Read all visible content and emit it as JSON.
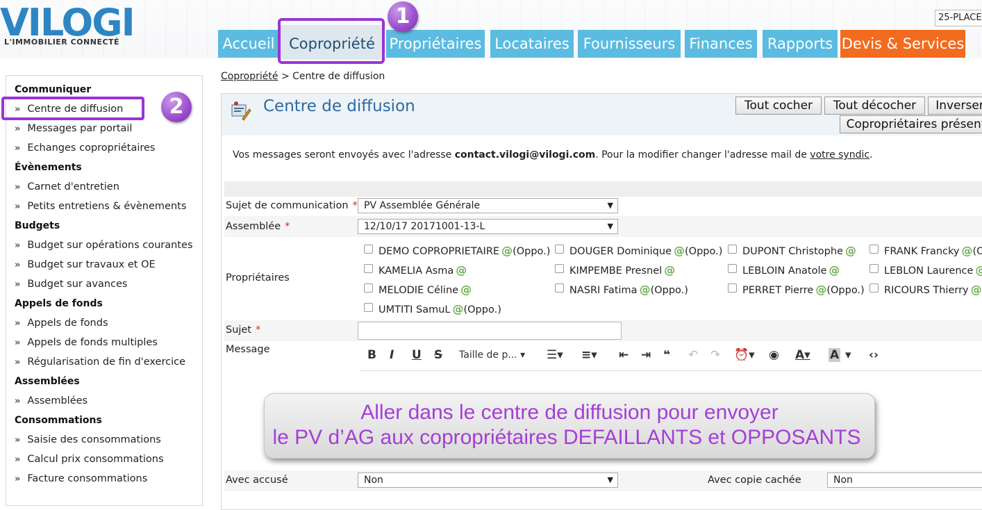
{
  "header": {
    "logo_word": "VILOGI",
    "logo_tagline": "L'IMMOBILIER CONNECTÉ",
    "building_selector": "25-PLACE",
    "tabs": [
      {
        "label": "Accueil"
      },
      {
        "label": "Copropriété"
      },
      {
        "label": "Propriétaires"
      },
      {
        "label": "Locataires"
      },
      {
        "label": "Fournisseurs"
      },
      {
        "label": "Finances"
      },
      {
        "label": "Rapports"
      },
      {
        "label": "Devis & Services"
      }
    ],
    "badge_1": "1",
    "badge_2": "2"
  },
  "sidebar": {
    "sections": [
      {
        "heading": "Communiquer",
        "items": [
          "Centre de diffusion",
          "Messages par portail",
          "Echanges copropriétaires"
        ]
      },
      {
        "heading": "Évènements",
        "items": [
          "Carnet d'entretien",
          "Petits entretiens & évènements"
        ]
      },
      {
        "heading": "Budgets",
        "items": [
          "Budget sur opérations courantes",
          "Budget sur travaux et OE",
          "Budget sur avances"
        ]
      },
      {
        "heading": "Appels de fonds",
        "items": [
          "Appels de fonds",
          "Appels de fonds multiples",
          "Régularisation de fin d'exercice"
        ]
      },
      {
        "heading": "Assemblées",
        "items": [
          "Assemblées"
        ]
      },
      {
        "heading": "Consommations",
        "items": [
          "Saisie des consommations",
          "Calcul prix consommations",
          "Facture consommations"
        ]
      }
    ]
  },
  "breadcrumb": {
    "parent": "Copropriété",
    "separator": " > ",
    "current": "Centre de diffusion"
  },
  "panel": {
    "title": "Centre de diffusion",
    "buttons": {
      "check_all": "Tout cocher",
      "uncheck_all": "Tout décocher",
      "invert": "Inverser",
      "present_owners": "Copropriétaires présent"
    },
    "info": {
      "prefix": "Vos messages seront envoyés avec l'adresse ",
      "email": "contact.vilogi@vilogi.com",
      "middle": ". Pour la modifier changer l'adresse mail de ",
      "link": "votre syndic",
      "suffix": "."
    }
  },
  "form": {
    "subject_comm_label": "Sujet de communication",
    "subject_comm_value": "PV Assemblée Générale",
    "assembly_label": "Assemblée",
    "assembly_value": "12/10/17 20171001-13-L",
    "owners_label": "Propriétaires",
    "owners": [
      {
        "name": "DEMO COPROPRIETAIRE",
        "oppo": "(Oppo.)"
      },
      {
        "name": "DOUGER Dominique",
        "oppo": "(Oppo.)"
      },
      {
        "name": "DUPONT Christophe",
        "oppo": ""
      },
      {
        "name": "FRANK Francky",
        "oppo": "(O"
      },
      {
        "name": "KAMELIA Asma",
        "oppo": ""
      },
      {
        "name": "KIMPEMBE Presnel",
        "oppo": ""
      },
      {
        "name": "LEBLOIN Anatole",
        "oppo": ""
      },
      {
        "name": "LEBLON Laurence",
        "oppo": ""
      },
      {
        "name": "MELODIE Céline",
        "oppo": ""
      },
      {
        "name": "NASRI Fatima",
        "oppo": "(Oppo.)"
      },
      {
        "name": "PERRET Pierre",
        "oppo": "(Oppo.)"
      },
      {
        "name": "RICOURS Thierry",
        "oppo": ""
      },
      {
        "name": "UMTITI SamuL",
        "oppo": "(Oppo.)"
      }
    ],
    "at_sign": "@",
    "required_mark": "*",
    "subject_label": "Sujet",
    "message_label": "Message",
    "font_size_placeholder": "Taille de p...",
    "ack_label": "Avec accusé",
    "ack_value": "Non",
    "bcc_label": "Avec copie cachée",
    "bcc_value": "Non"
  },
  "callout": {
    "line1": "Aller dans le centre de diffusion pour envoyer",
    "line2": "le PV d’AG aux copropriétaires DEFAILLANTS et OPPOSANTS"
  },
  "colors": {
    "tab_blue": "#5bbbe0",
    "tab_orange": "#f26b1f",
    "highlight_purple": "#9a34d6",
    "title_blue": "#2c6aa0",
    "at_green": "#6ab04c"
  }
}
